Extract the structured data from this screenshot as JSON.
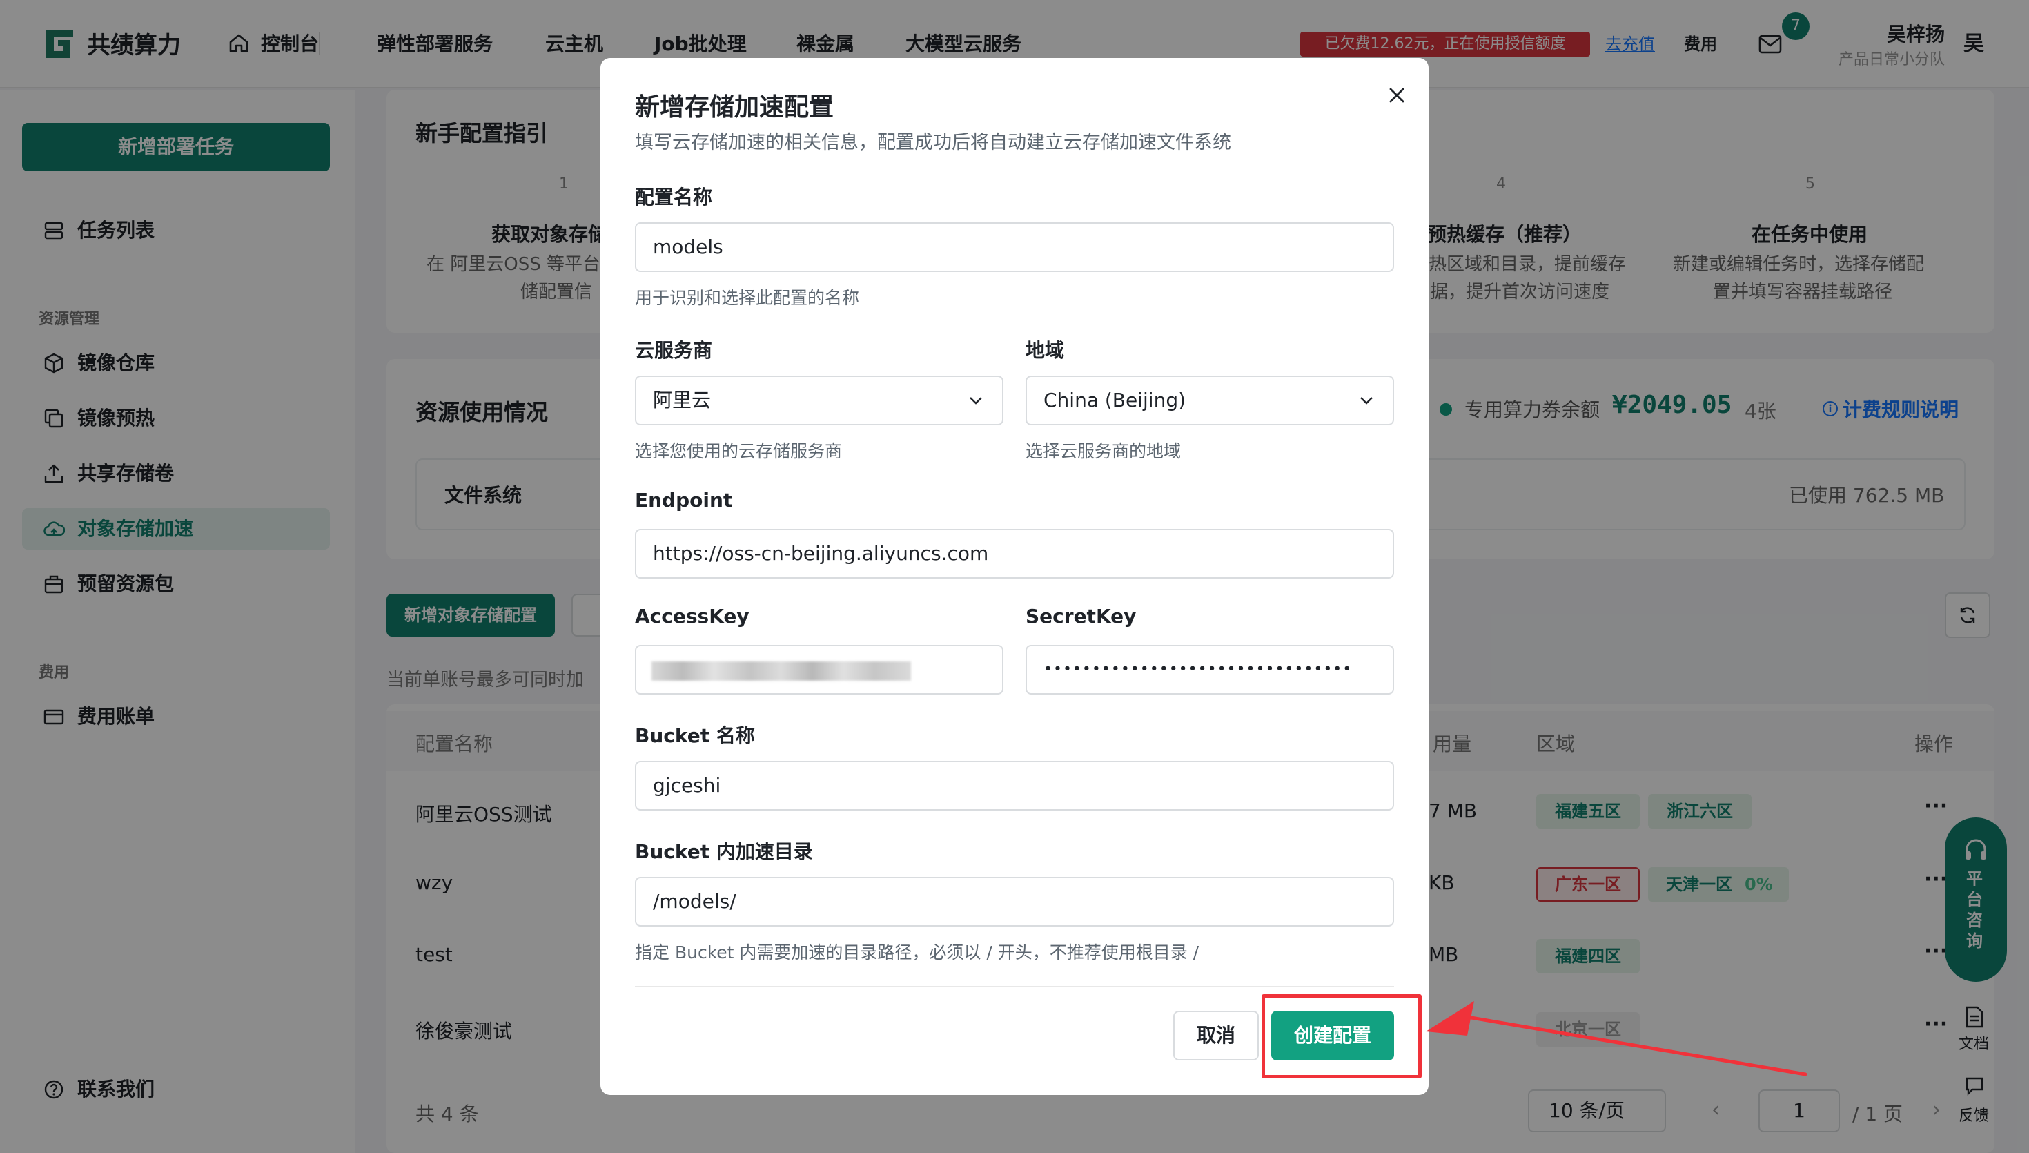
{
  "brand": {
    "name": "共绩算力",
    "accent": "#12806e"
  },
  "topnav": {
    "items": [
      "控制台",
      "弹性部署服务",
      "云主机",
      "Job批处理",
      "裸金属",
      "大模型云服务"
    ],
    "arrears": "已欠费12.62元，正在使用授信额度",
    "recharge": "去充值",
    "fee": "费用",
    "mail_badge": "7",
    "user_name": "吴梓扬",
    "user_team": "产品日常小分队",
    "avatar_char": "吴"
  },
  "sidebar": {
    "new_task": "新增部署任务",
    "items": [
      {
        "label": "任务列表",
        "icon": "list-icon"
      },
      {
        "label": "镜像仓库",
        "icon": "cube-icon"
      },
      {
        "label": "镜像预热",
        "icon": "copy-icon"
      },
      {
        "label": "共享存储卷",
        "icon": "upload-icon"
      },
      {
        "label": "对象存储加速",
        "icon": "cloud-icon"
      },
      {
        "label": "预留资源包",
        "icon": "package-icon"
      },
      {
        "label": "费用账单",
        "icon": "card-icon"
      },
      {
        "label": "联系我们",
        "icon": "help-icon"
      }
    ],
    "groups": [
      "资源管理",
      "费用"
    ]
  },
  "guide": {
    "title": "新手配置指引",
    "steps": [
      {
        "num": "1",
        "title": "获取对象存储",
        "desc1": "在 阿里云OSS 等平台",
        "desc2": "储配置信"
      },
      {
        "num": "4",
        "title": "预热缓存（推荐）",
        "desc1": "热区域和目录，提前缓存",
        "desc2": "据，提升首次访问速度"
      },
      {
        "num": "5",
        "title": "在任务中使用",
        "desc1": "新建或编辑任务时，选择存储配",
        "desc2": "置并填写容器挂载路径"
      }
    ]
  },
  "usage": {
    "title": "资源使用情况",
    "voucher_label": "专用算力券余额",
    "voucher_amount": "¥2049.05",
    "voucher_count": "4张",
    "billing_link": "计费规则说明",
    "fs_label": "文件系统",
    "fs_used": "已使用 762.5 MB"
  },
  "table": {
    "new_button": "新增对象存储配置",
    "notice": "当前单账号最多可同时加",
    "headers": {
      "name": "配置名称",
      "usage": "用量",
      "region": "区域",
      "action": "操作"
    },
    "rows": [
      {
        "name": "阿里云OSS测试",
        "usage": "7 MB",
        "regions": [
          "福建五区",
          "浙江六区"
        ],
        "extra": ""
      },
      {
        "name": "wzy",
        "usage": "KB",
        "regions": [
          "广东一区",
          "天津一区"
        ],
        "extra": "0%"
      },
      {
        "name": "test",
        "usage": "MB",
        "regions": [
          "福建四区"
        ],
        "extra": ""
      },
      {
        "name": "徐俊豪测试",
        "usage": "",
        "regions": [
          "北京一区"
        ],
        "extra": ""
      }
    ],
    "more": "···",
    "total": "共 4 条",
    "page_size": "10 条/页",
    "page_current": "1",
    "page_total": "/ 1 页"
  },
  "floating": {
    "consult": "平台咨询",
    "docs": "文档",
    "feedback": "反馈"
  },
  "modal": {
    "title": "新增存储加速配置",
    "subtitle": "填写云存储加速的相关信息，配置成功后将自动建立云存储加速文件系统",
    "name_label": "配置名称",
    "name_value": "models",
    "name_hint": "用于识别和选择此配置的名称",
    "provider_label": "云服务商",
    "provider_value": "阿里云",
    "provider_hint": "选择您使用的云存储服务商",
    "region_label": "地域",
    "region_value": "China (Beijing)",
    "region_hint": "选择云服务商的地域",
    "endpoint_label": "Endpoint",
    "endpoint_value": "https://oss-cn-beijing.aliyuncs.com",
    "accesskey_label": "AccessKey",
    "secretkey_label": "SecretKey",
    "secretkey_value": "••••••••••••••••••••••••••••••••",
    "bucket_label": "Bucket 名称",
    "bucket_value": "gjceshi",
    "dir_label": "Bucket 内加速目录",
    "dir_value": "/models/",
    "dir_hint": "指定 Bucket 内需要加速的目录路径，必须以 / 开头，不推荐使用根目录 /",
    "cancel": "取消",
    "create": "创建配置"
  },
  "colors": {
    "primary": "#12a181",
    "danger": "#f0323a",
    "link": "#1677ff"
  }
}
